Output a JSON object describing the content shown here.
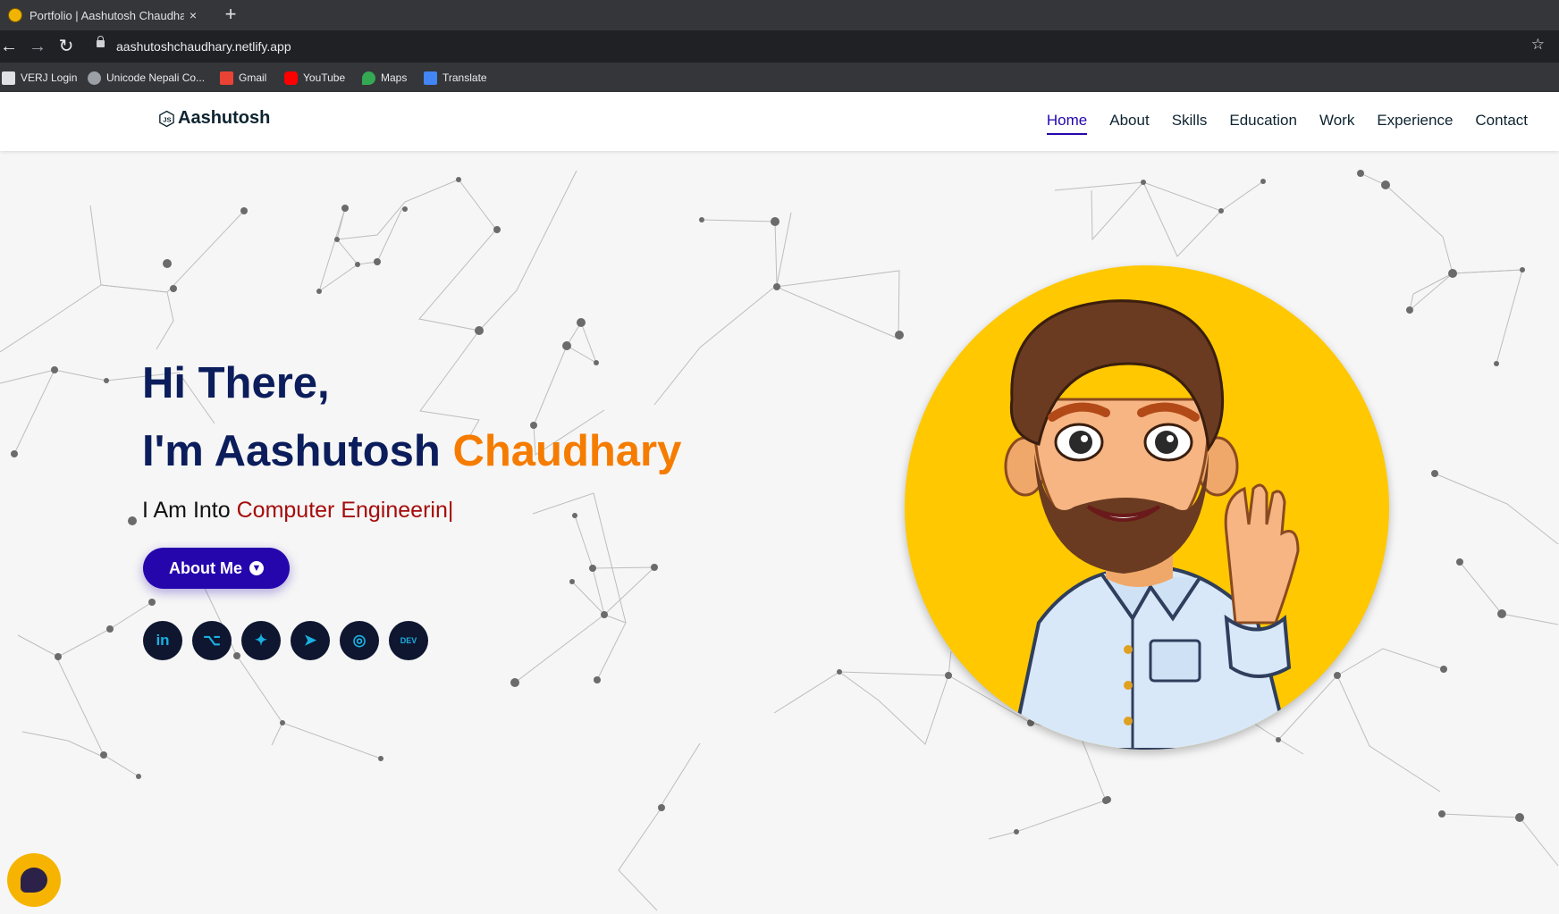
{
  "browser": {
    "tab_title": "Portfolio | Aashutosh Chaudhary",
    "tab_close": "×",
    "new_tab": "+",
    "url": "aashutoshchaudhary.netlify.app",
    "back": "←",
    "forward": "→",
    "reload": "↻",
    "star": "☆",
    "bookmarks": [
      {
        "label": "VERJ Login",
        "icon": "doc-icon",
        "color": "#9aa0a6"
      },
      {
        "label": "Unicode Nepali Co...",
        "icon": "globe-icon",
        "color": "#9aa0a6"
      },
      {
        "label": "Gmail",
        "icon": "gmail-icon",
        "color": "#ea4335"
      },
      {
        "label": "YouTube",
        "icon": "youtube-icon",
        "color": "#ff0000"
      },
      {
        "label": "Maps",
        "icon": "maps-icon",
        "color": "#34a853"
      },
      {
        "label": "Translate",
        "icon": "translate-icon",
        "color": "#4285f4"
      }
    ]
  },
  "site": {
    "logo_text": "Aashutosh",
    "nav": [
      "Home",
      "About",
      "Skills",
      "Education",
      "Work",
      "Experience",
      "Contact"
    ],
    "active_nav": "Home"
  },
  "hero": {
    "greeting": "Hi There,",
    "name_prefix": "I'm Aashutosh ",
    "name_highlight": "Chaudhary",
    "typed_prefix": "I Am Into ",
    "typed_text": "Computer Engineerin|",
    "about_button": "About Me",
    "socials": [
      {
        "name": "linkedin-icon",
        "glyph": "in"
      },
      {
        "name": "github-icon",
        "glyph": "⌥"
      },
      {
        "name": "twitter-icon",
        "glyph": "✦"
      },
      {
        "name": "telegram-icon",
        "glyph": "➤"
      },
      {
        "name": "instagram-icon",
        "glyph": "◎"
      },
      {
        "name": "dev-icon",
        "glyph": "DEV"
      }
    ]
  },
  "colors": {
    "accent": "#2506ad",
    "name_highlight": "#f57c00",
    "heading": "#0c1d5c",
    "typed": "#a50b0b",
    "avatar_bg": "#ffc800"
  }
}
